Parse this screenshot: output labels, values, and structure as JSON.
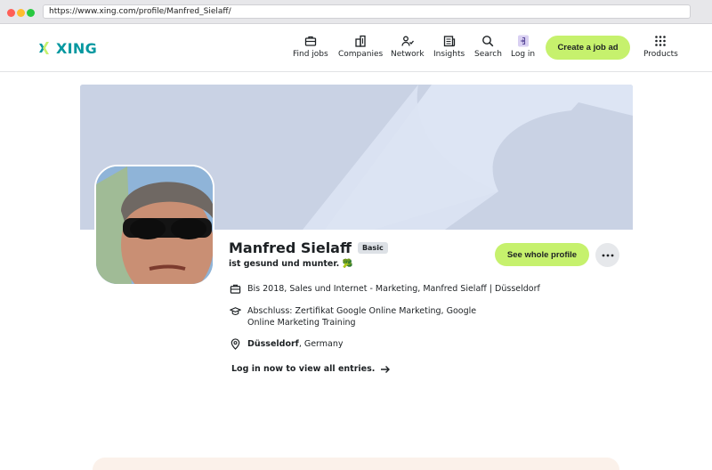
{
  "browser": {
    "url": "https://www.xing.com/profile/Manfred_Sielaff/"
  },
  "header": {
    "logo_text": "XING",
    "nav": [
      {
        "label": "Find jobs",
        "icon": "briefcase-icon"
      },
      {
        "label": "Companies",
        "icon": "building-icon"
      },
      {
        "label": "Network",
        "icon": "people-icon"
      },
      {
        "label": "Insights",
        "icon": "newspaper-icon"
      },
      {
        "label": "Search",
        "icon": "search-icon"
      },
      {
        "label": "Log in",
        "icon": "login-icon"
      }
    ],
    "cta_label": "Create a job ad",
    "products_label": "Products"
  },
  "profile": {
    "name": "Manfred Sielaff",
    "badge": "Basic",
    "status": "ist gesund und munter. 🥦",
    "see_profile_label": "See whole profile",
    "job": "Bis 2018, Sales und Internet - Marketing, Manfred Sielaff | Düsseldorf",
    "education": "Abschluss: Zertifikat Google Online Marketing, Google Online Marketing Training",
    "location_city": "Düsseldorf",
    "location_country": ", Germany",
    "login_link": "Log in now to view all entries."
  },
  "colors": {
    "brand": "#0698a0",
    "accent": "#c6f16d",
    "cover": "#c9d2e4"
  }
}
